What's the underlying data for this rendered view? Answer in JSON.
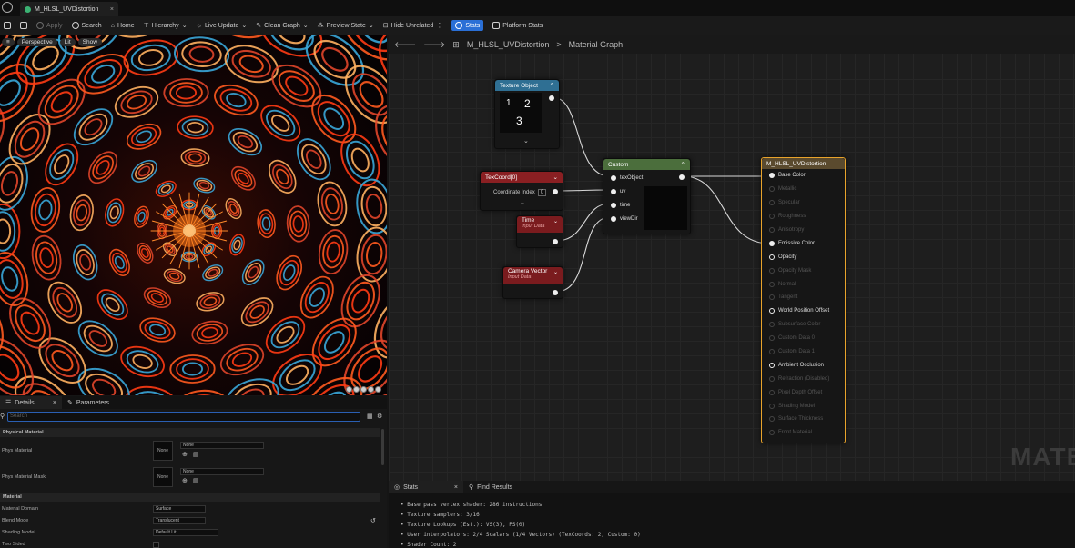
{
  "tab": {
    "title": "M_HLSL_UVDistortion",
    "close": "×"
  },
  "toolbar": {
    "apply": "Apply",
    "search": "Search",
    "home": "Home",
    "hierarchy": "Hierarchy",
    "live_update": "Live Update",
    "clean_graph": "Clean Graph",
    "preview_state": "Preview State",
    "hide_unrelated": "Hide Unrelated",
    "stats": "Stats",
    "platform_stats": "Platform Stats"
  },
  "viewport": {
    "perspective": "Perspective",
    "lit": "Lit",
    "show": "Show"
  },
  "graph": {
    "breadcrumb_asset": "M_HLSL_UVDistortion",
    "breadcrumb_sep": ">",
    "breadcrumb_graph": "Material Graph",
    "watermark": "MATE"
  },
  "nodes": {
    "texture_object": {
      "title": "Texture Object",
      "n1": "1",
      "n2": "2",
      "n3": "3"
    },
    "texcoord": {
      "title": "TexCoord[0]",
      "coord_label": "Coordinate Index",
      "coord_value": "0"
    },
    "time": {
      "title": "Time",
      "sub": "Input Data"
    },
    "camera_vector": {
      "title": "Camera Vector",
      "sub": "Input Data"
    },
    "custom": {
      "title": "Custom",
      "in1": "texObject",
      "in2": "uv",
      "in3": "time",
      "in4": "viewDir"
    },
    "result": {
      "title": "M_HLSL_UVDistortion",
      "pins": [
        {
          "label": "Base Color",
          "active": true
        },
        {
          "label": "Metallic",
          "active": false
        },
        {
          "label": "Specular",
          "active": false
        },
        {
          "label": "Roughness",
          "active": false
        },
        {
          "label": "Anisotropy",
          "active": false
        },
        {
          "label": "Emissive Color",
          "active": true
        },
        {
          "label": "Opacity",
          "active": true
        },
        {
          "label": "Opacity Mask",
          "active": false
        },
        {
          "label": "Normal",
          "active": false
        },
        {
          "label": "Tangent",
          "active": false
        },
        {
          "label": "World Position Offset",
          "active": true
        },
        {
          "label": "Subsurface Color",
          "active": false
        },
        {
          "label": "Custom Data 0",
          "active": false
        },
        {
          "label": "Custom Data 1",
          "active": false
        },
        {
          "label": "Ambient Occlusion",
          "active": true
        },
        {
          "label": "Refraction (Disabled)",
          "active": false
        },
        {
          "label": "Pixel Depth Offset",
          "active": false
        },
        {
          "label": "Shading Model",
          "active": false
        },
        {
          "label": "Surface Thickness",
          "active": false
        },
        {
          "label": "Front Material",
          "active": false
        }
      ]
    }
  },
  "details": {
    "tab_details": "Details",
    "tab_close": "×",
    "tab_parameters": "Parameters",
    "search_placeholder": "Search",
    "section_phys": "Physical Material",
    "phys_material": "Phys Material",
    "phys_material_mask": "Phys Material Mask",
    "none": "None",
    "section_material": "Material",
    "material_domain": "Material Domain",
    "material_domain_value": "Surface",
    "blend_mode": "Blend Mode",
    "blend_mode_value": "Translucent",
    "shading_model": "Shading Model",
    "shading_model_value": "Default Lit",
    "two_sided": "Two Sided"
  },
  "stats": {
    "tab_stats": "Stats",
    "tab_close": "×",
    "tab_find": "Find Results",
    "lines": [
      "Base pass vertex shader: 286 instructions",
      "Texture samplers: 3/16",
      "Texture Lookups (Est.): VS(3), PS(0)",
      "User interpolators: 2/4 Scalars (1/4 Vectors) (TexCoords: 2, Custom: 0)",
      "Shader Count: 2"
    ]
  }
}
